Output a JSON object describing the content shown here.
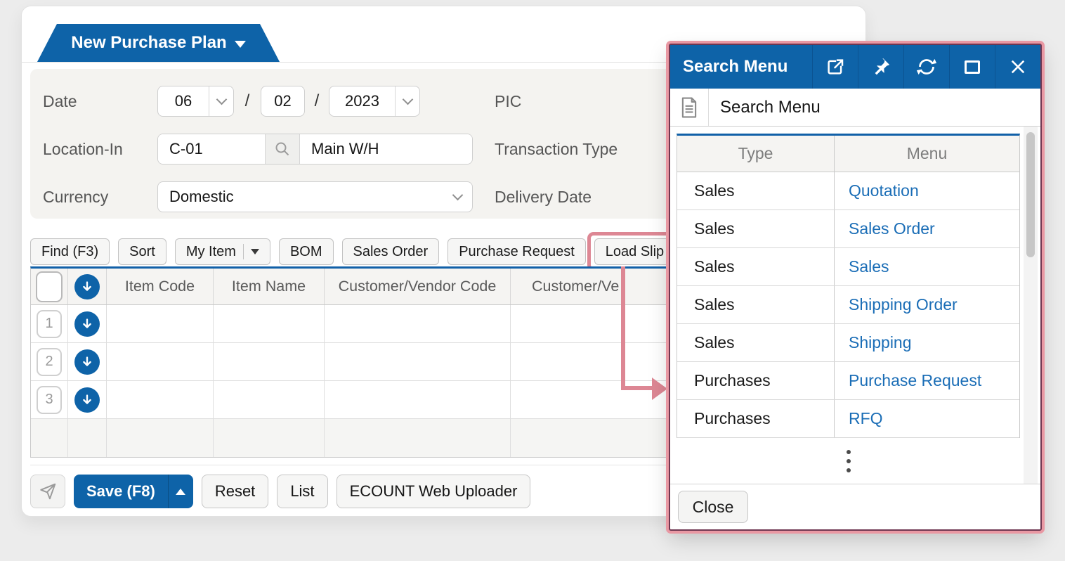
{
  "main_window": {
    "tab": {
      "label": "New Purchase Plan"
    },
    "form": {
      "date": {
        "label": "Date",
        "month": "06",
        "separator1": "/",
        "day": "02",
        "separator2": "/",
        "year": "2023"
      },
      "location": {
        "label": "Location-In",
        "code": "C-01",
        "name": "Main W/H"
      },
      "currency": {
        "label": "Currency",
        "value": "Domestic"
      },
      "pic_label": "PIC",
      "transaction_type_label": "Transaction Type",
      "delivery_date_label": "Delivery Date"
    },
    "toolbar": {
      "buttons": [
        {
          "label": "Find (F3)"
        },
        {
          "label": "Sort"
        },
        {
          "label": "My Item"
        },
        {
          "label": "BOM"
        },
        {
          "label": "Sales Order"
        },
        {
          "label": "Purchase Request"
        },
        {
          "label": "Load Slip",
          "highlighted": true
        }
      ]
    },
    "grid": {
      "headers": [
        "Item Code",
        "Item Name",
        "Customer/Vendor Code",
        "Customer/Ve"
      ],
      "row_numbers": [
        "1",
        "2",
        "3"
      ]
    },
    "footer": {
      "save_label": "Save (F8)",
      "reset_label": "Reset",
      "list_label": "List",
      "uploader_label": "ECOUNT Web Uploader"
    }
  },
  "popup": {
    "title": "Search Menu",
    "subtitle": "Search Menu",
    "table": {
      "columns": [
        "Type",
        "Menu"
      ],
      "rows": [
        {
          "type": "Sales",
          "menu": "Quotation"
        },
        {
          "type": "Sales",
          "menu": "Sales Order"
        },
        {
          "type": "Sales",
          "menu": "Sales"
        },
        {
          "type": "Sales",
          "menu": "Shipping Order"
        },
        {
          "type": "Sales",
          "menu": "Shipping"
        },
        {
          "type": "Purchases",
          "menu": "Purchase Request"
        },
        {
          "type": "Purchases",
          "menu": "RFQ"
        }
      ]
    },
    "close_label": "Close"
  },
  "colors": {
    "primary_blue": "#0e63a8",
    "link_blue": "#1a6db6",
    "highlight_pink": "#dd8794",
    "popup_border_dark": "#6e3751",
    "popup_border_pink": "#e998a3",
    "grid_top_border_blue": "#1160a8"
  }
}
